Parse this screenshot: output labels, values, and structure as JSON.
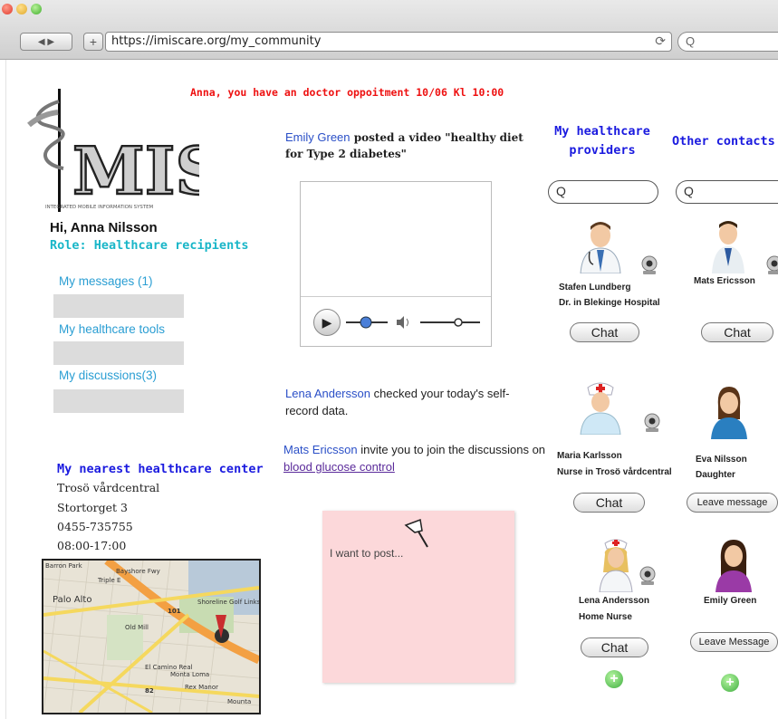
{
  "browser": {
    "url": "https://imiscare.org/my_community",
    "nav_label": "◀ ▶",
    "add_tab_label": "+",
    "reload_icon": "⟳",
    "search_placeholder": "Q"
  },
  "alert": "Anna, you have an doctor oppoitment 10/06 Kl 10:00",
  "logo": {
    "text": "MIS",
    "tagline": "INTEGRATED MOBILE INFORMATION SYSTEM"
  },
  "user": {
    "greeting": "Hi, Anna Nilsson",
    "role": "Role: Healthcare recipients"
  },
  "menu": {
    "messages": "My messages (1)",
    "tools": "My healthcare tools",
    "discussions": "My discussions(3)"
  },
  "center": {
    "heading": "My nearest healthcare center",
    "name": "Trosö vårdcentral",
    "address": "Stortorget 3",
    "phone": "0455-735755",
    "hours": "08:00-17:00"
  },
  "map": {
    "labels": [
      "Palo Alto",
      "101",
      "Shoreline Golf Links",
      "82",
      "El Camino Real",
      "Monta Loma",
      "Mounta",
      "Rex Manor",
      "Bayshore Fwy",
      "Old Mill",
      "Barron Park",
      "Triple E"
    ]
  },
  "feed": {
    "post1_name": "Emily Green",
    "post1_text": " posted a video \"healthy diet for Type 2 diabetes\"",
    "post2_name": "Lena Andersson",
    "post2_text": " checked your today's self-record data.",
    "post3_name": "Mats Ericsson",
    "post3_text": " invite you to join the discussions on ",
    "post3_link": "blood glucose control",
    "post_placeholder": "I want to post..."
  },
  "contacts": {
    "providers_heading_1": "My healthcare",
    "providers_heading_2": "providers",
    "others_heading": "Other contacts",
    "search_icon": "Q",
    "providers": [
      {
        "name": "Stafen Lundberg",
        "detail": "Dr. in Blekinge Hospital",
        "button": "Chat"
      },
      {
        "name": "Maria Karlsson",
        "detail": "Nurse in Trosö vårdcentral",
        "button": "Chat"
      },
      {
        "name": "Lena Andersson",
        "detail": "Home Nurse",
        "button": "Chat"
      }
    ],
    "others": [
      {
        "name": "Mats Ericsson",
        "detail": "",
        "button": "Chat"
      },
      {
        "name": "Eva Nilsson",
        "detail": "Daughter",
        "button": "Leave message"
      },
      {
        "name": "Emily Green",
        "detail": "",
        "button": "Leave Message"
      }
    ],
    "add_icon": "+"
  },
  "colors": {
    "alert": "#ee1111",
    "link": "#2a9ed3",
    "heading": "#1a1adf",
    "role": "#19b6c8",
    "post_bg": "#fcd8da"
  }
}
